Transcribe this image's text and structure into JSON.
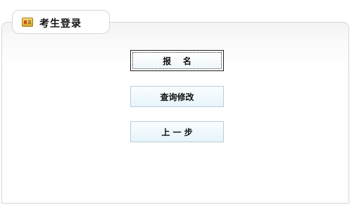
{
  "tab": {
    "title": "考生登录",
    "icon": "id-card-icon"
  },
  "buttons": {
    "register": "报    名",
    "query_modify": "查询修改",
    "previous_step": "上 一 步"
  },
  "colors": {
    "button_border": "#b9cdd8",
    "button_fill": "#e6f4fb",
    "panel_border": "#d7d7d7"
  }
}
